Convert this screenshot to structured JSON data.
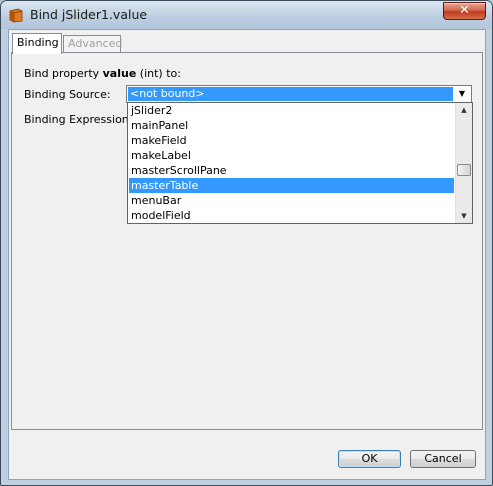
{
  "window": {
    "title": "Bind jSlider1.value",
    "close_label": "✕"
  },
  "tabs": [
    {
      "label": "Binding",
      "active": true,
      "enabled": true
    },
    {
      "label": "Advanced",
      "active": false,
      "enabled": false
    }
  ],
  "form": {
    "property_prefix": "Bind property ",
    "property_name": "value",
    "property_suffix": " (int) to:",
    "binding_source_label": "Binding Source:",
    "binding_source_value": "<not bound>",
    "binding_expression_label": "Binding Expression:"
  },
  "dropdown": {
    "items": [
      "jSlider2",
      "mainPanel",
      "makeField",
      "makeLabel",
      "masterScrollPane",
      "masterTable",
      "menuBar",
      "modelField"
    ],
    "selected": "masterTable"
  },
  "buttons": {
    "ok": "OK",
    "cancel": "Cancel"
  },
  "icons": {
    "title": "netbeans-app-icon",
    "dropdown_arrow": "chevron-down-icon"
  }
}
